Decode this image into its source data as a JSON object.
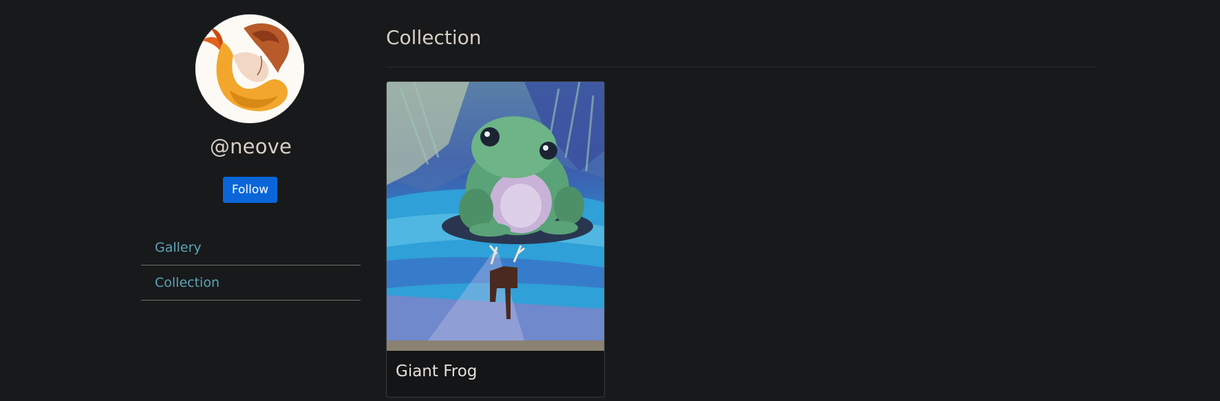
{
  "profile": {
    "username": "@neove",
    "follow_label": "Follow",
    "avatar_icon": "mermaid-artwork"
  },
  "sidebar": {
    "items": [
      {
        "label": "Gallery"
      },
      {
        "label": "Collection"
      }
    ]
  },
  "main": {
    "title": "Collection",
    "cards": [
      {
        "title": "Giant Frog",
        "image_icon": "frog-painting"
      }
    ]
  },
  "colors": {
    "background": "#18191b",
    "accent_button": "#0a66d8",
    "link": "#5aa6b8",
    "text": "#d6d0c4"
  }
}
